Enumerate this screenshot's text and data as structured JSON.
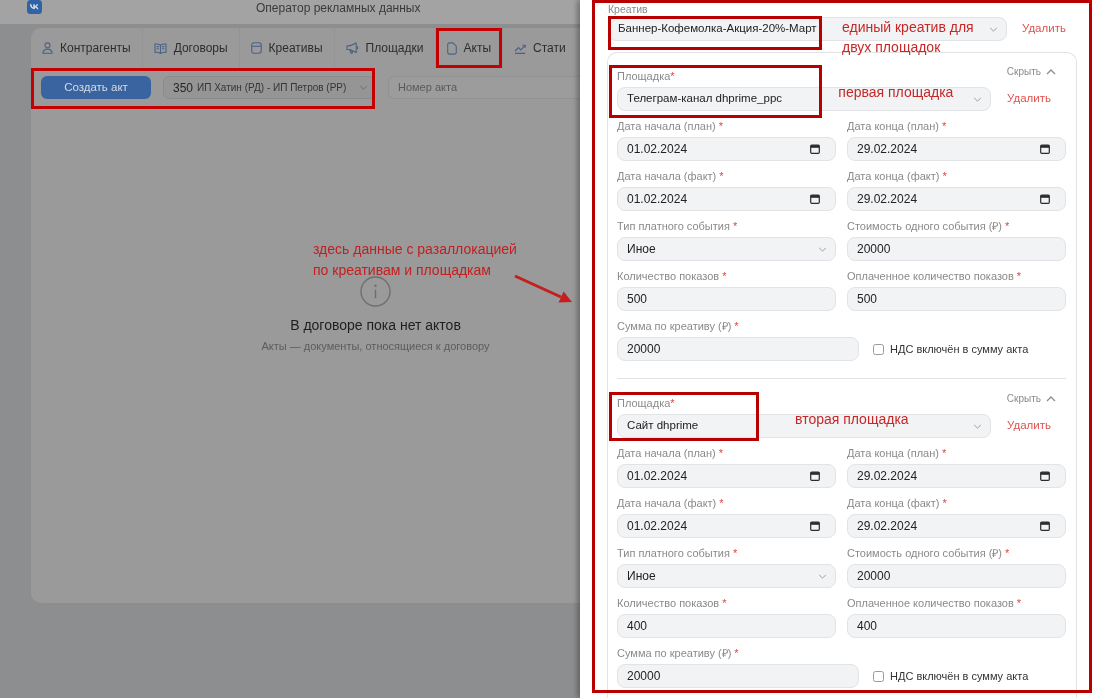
{
  "header": {
    "title": "Оператор рекламных данных"
  },
  "tabs": [
    {
      "label": "Контрагенты",
      "highlighted": false
    },
    {
      "label": "Договоры",
      "highlighted": false
    },
    {
      "label": "Креативы",
      "highlighted": false
    },
    {
      "label": "Площадки",
      "highlighted": false
    },
    {
      "label": "Акты",
      "highlighted": true
    },
    {
      "label": "Стати",
      "highlighted": false
    }
  ],
  "toolbar": {
    "highlighted": true,
    "create_button": "Создать акт",
    "contract_select": {
      "number": "350",
      "parties": "ИП Хатин (РД) - ИП Петров (РР)"
    },
    "act_number_field": {
      "placeholder": "Номер акта"
    }
  },
  "empty_state": {
    "title": "В договоре пока нет актов",
    "subtitle": "Акты — документы, относящиеся к договору",
    "note": "здесь данные с разаллокацией\nпо креативам и площадкам"
  },
  "panel": {
    "highlighted": true,
    "creative": {
      "label": "Креатив",
      "value": "Баннер-Кофемолка-Акция-20%-Март",
      "delete_link": "Удалить",
      "highlighted": true,
      "note": "единый креатив для\nдвух площадок"
    },
    "platforms": [
      {
        "label": "Площадка",
        "required_mark": "*",
        "hide_link": "Скрыть",
        "expanded": true,
        "value": "Телеграм-канал dhprime_ppc",
        "delete_link": "Удалить",
        "highlighted": true,
        "note": "первая площадка",
        "fields": [
          {
            "kind": "date",
            "label": "Дата начала (план)",
            "required_mark": "*",
            "value": "01.02.2024"
          },
          {
            "kind": "date",
            "label": "Дата конца (план)",
            "required_mark": "*",
            "value": "29.02.2024"
          },
          {
            "kind": "date",
            "label": "Дата начала (факт)",
            "required_mark": "*",
            "value": "01.02.2024"
          },
          {
            "kind": "date",
            "label": "Дата конца (факт)",
            "required_mark": "*",
            "value": "29.02.2024"
          },
          {
            "kind": "select",
            "label": "Тип платного события",
            "required_mark": "*",
            "value": "Иное"
          },
          {
            "kind": "text",
            "label": "Стоимость одного события (₽)",
            "required_mark": "*",
            "value": "20000"
          },
          {
            "kind": "text",
            "label": "Количество показов",
            "required_mark": "*",
            "value": "500"
          },
          {
            "kind": "text",
            "label": "Оплаченное количество показов",
            "required_mark": "*",
            "value": "500"
          }
        ],
        "amount_field": {
          "label": "Сумма по креативу (₽)",
          "required_mark": "*",
          "value": "20000"
        },
        "vat_checkbox": {
          "label": "НДС включён в сумму акта",
          "checked": false
        }
      },
      {
        "label": "Площадка",
        "required_mark": "*",
        "hide_link": "Скрыть",
        "expanded": true,
        "value": "Сайт dhprime",
        "delete_link": "Удалить",
        "highlighted": true,
        "note": "вторая площадка",
        "fields": [
          {
            "kind": "date",
            "label": "Дата начала (план)",
            "required_mark": "*",
            "value": "01.02.2024"
          },
          {
            "kind": "date",
            "label": "Дата конца (план)",
            "required_mark": "*",
            "value": "29.02.2024"
          },
          {
            "kind": "date",
            "label": "Дата начала (факт)",
            "required_mark": "*",
            "value": "01.02.2024"
          },
          {
            "kind": "date",
            "label": "Дата конца (факт)",
            "required_mark": "*",
            "value": "29.02.2024"
          },
          {
            "kind": "select",
            "label": "Тип платного события",
            "required_mark": "*",
            "value": "Иное"
          },
          {
            "kind": "text",
            "label": "Стоимость одного события (₽)",
            "required_mark": "*",
            "value": "20000"
          },
          {
            "kind": "text",
            "label": "Количество показов",
            "required_mark": "*",
            "value": "400"
          },
          {
            "kind": "text",
            "label": "Оплаченное количество показов",
            "required_mark": "*",
            "value": "400"
          }
        ],
        "amount_field": {
          "label": "Сумма по креативу (₽)",
          "required_mark": "*",
          "value": "20000"
        },
        "vat_checkbox": {
          "label": "НДС включён в сумму акта",
          "checked": false
        }
      }
    ]
  }
}
